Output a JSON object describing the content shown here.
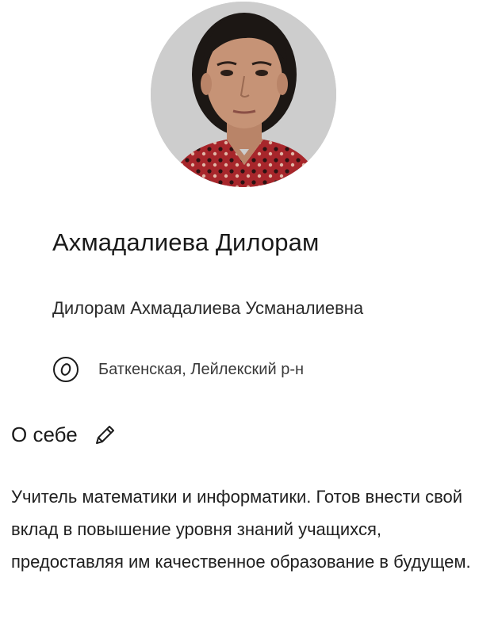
{
  "profile": {
    "display_name": "Ахмадалиева Дилорам",
    "full_name": "Дилорам Ахмадалиева Усманалиевна",
    "location": "Баткенская, Лейлекский р-н",
    "avatar_icon": "user-photo"
  },
  "about": {
    "title": "О себе",
    "edit_icon": "pencil-icon",
    "text": "Учитель математики и информатики. Готов внести свой вклад в повышение уровня знаний учащихся, предоставляя им качественное образование в будущем."
  },
  "colors": {
    "text_primary": "#1a1a1a",
    "text_secondary": "#3a3a3a",
    "background": "#ffffff"
  }
}
